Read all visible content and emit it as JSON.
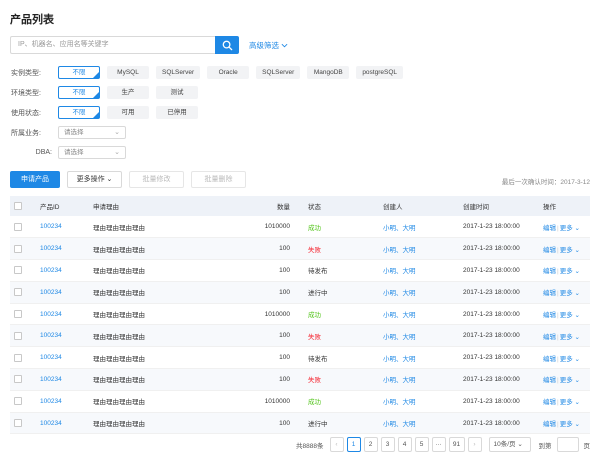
{
  "page": {
    "title": "产品列表"
  },
  "search": {
    "placeholder": "IP、机器名、应用名等关键字",
    "advanced_label": "高级筛选"
  },
  "filters": {
    "instance_type": {
      "label": "实例类型:",
      "options": [
        "不限",
        "MySQL",
        "SQLServer",
        "Oracle",
        "SQLServer",
        "MangoDB",
        "postgreSQL"
      ],
      "selected": 0
    },
    "env_type": {
      "label": "环境类型:",
      "options": [
        "不限",
        "生产",
        "测试"
      ],
      "selected": 0
    },
    "use_status": {
      "label": "使用状态:",
      "options": [
        "不限",
        "可用",
        "已停用"
      ],
      "selected": 0
    },
    "business": {
      "label": "所属业务:",
      "value": "请选择"
    },
    "dba": {
      "label": "DBA:",
      "value": "请选择"
    }
  },
  "toolbar": {
    "apply_label": "申请产品",
    "more_label": "更多操作",
    "batch_edit_label": "批量修改",
    "batch_delete_label": "批量删除",
    "last_confirm": "最后一次确认时间：2017-3-12"
  },
  "table": {
    "headers": {
      "id": "产品ID",
      "reason": "申请理由",
      "qty": "数量",
      "status": "状态",
      "creator": "创建人",
      "created": "创建时间",
      "ops": "操作"
    },
    "rows": [
      {
        "id": "100234",
        "reason": "理由理由理由理由",
        "qty": "1010000",
        "status": "成功",
        "status_kind": "success",
        "creator": "小明、大明",
        "created": "2017-1-23 18:00:00"
      },
      {
        "id": "100234",
        "reason": "理由理由理由理由",
        "qty": "100",
        "status": "失败",
        "status_kind": "fail",
        "creator": "小明、大明",
        "created": "2017-1-23 18:00:00"
      },
      {
        "id": "100234",
        "reason": "理由理由理由理由",
        "qty": "100",
        "status": "待发布",
        "status_kind": "neutral",
        "creator": "小明、大明",
        "created": "2017-1-23 18:00:00"
      },
      {
        "id": "100234",
        "reason": "理由理由理由理由",
        "qty": "100",
        "status": "进行中",
        "status_kind": "neutral",
        "creator": "小明、大明",
        "created": "2017-1-23 18:00:00"
      },
      {
        "id": "100234",
        "reason": "理由理由理由理由",
        "qty": "1010000",
        "status": "成功",
        "status_kind": "success",
        "creator": "小明、大明",
        "created": "2017-1-23 18:00:00"
      },
      {
        "id": "100234",
        "reason": "理由理由理由理由",
        "qty": "100",
        "status": "失败",
        "status_kind": "fail",
        "creator": "小明、大明",
        "created": "2017-1-23 18:00:00"
      },
      {
        "id": "100234",
        "reason": "理由理由理由理由",
        "qty": "100",
        "status": "待发布",
        "status_kind": "neutral",
        "creator": "小明、大明",
        "created": "2017-1-23 18:00:00"
      },
      {
        "id": "100234",
        "reason": "理由理由理由理由",
        "qty": "100",
        "status": "失败",
        "status_kind": "fail",
        "creator": "小明、大明",
        "created": "2017-1-23 18:00:00"
      },
      {
        "id": "100234",
        "reason": "理由理由理由理由",
        "qty": "1010000",
        "status": "成功",
        "status_kind": "success",
        "creator": "小明、大明",
        "created": "2017-1-23 18:00:00"
      },
      {
        "id": "100234",
        "reason": "理由理由理由理由",
        "qty": "100",
        "status": "进行中",
        "status_kind": "neutral",
        "creator": "小明、大明",
        "created": "2017-1-23 18:00:00"
      }
    ],
    "op_edit": "编辑",
    "op_more": "更多"
  },
  "pagination": {
    "total": "共8888条",
    "pages": [
      "1",
      "2",
      "3",
      "4",
      "5",
      "···",
      "91"
    ],
    "current": "1",
    "page_size": "10条/页",
    "jump_label": "到第",
    "page_unit": "页"
  },
  "colors": {
    "primary": "#1e88e5",
    "success": "#52c41a",
    "fail": "#f5222d"
  }
}
